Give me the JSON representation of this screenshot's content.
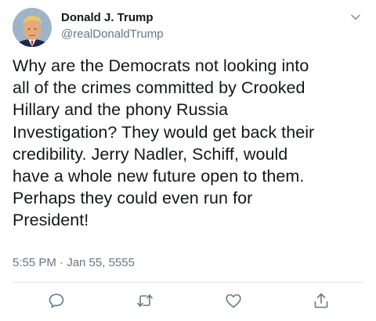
{
  "tweet": {
    "author": {
      "display_name": "Donald J. Trump",
      "handle": "@realDonaldTrump",
      "avatar_icon": "profile-photo"
    },
    "text": "Why are the Democrats not looking into\nall of the crimes committed by Crooked\nHillary and the phony Russia\nInvestigation? They would get back their\ncredibility. Jerry Nadler, Schiff, would\nhave a whole new future open to them.\nPerhaps they could even run for\nPresident!",
    "timestamp": "5:55 PM · Jan 55, 5555",
    "menu_icon": "chevron-down-icon",
    "actions": [
      {
        "name": "reply",
        "icon": "speech-bubble-icon"
      },
      {
        "name": "retweet",
        "icon": "retweet-arrows-icon"
      },
      {
        "name": "like",
        "icon": "heart-icon"
      },
      {
        "name": "share",
        "icon": "share-upload-icon"
      }
    ],
    "colors": {
      "text": "#14171a",
      "secondary": "#657786",
      "divider": "#e1e8ed",
      "icon": "#657786"
    }
  }
}
